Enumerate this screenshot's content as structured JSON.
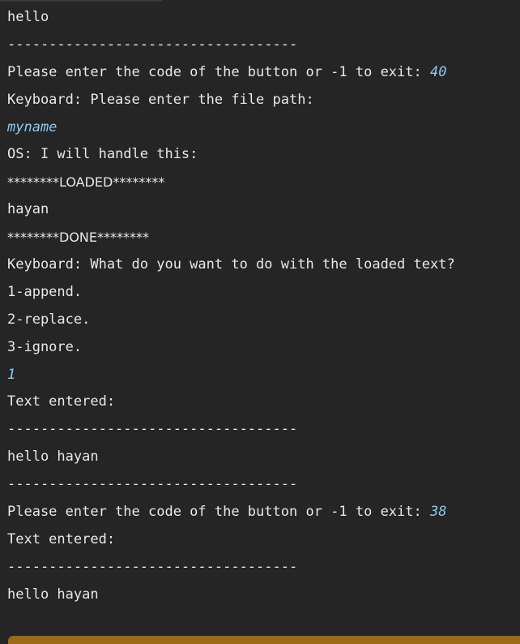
{
  "terminal": {
    "lines": [
      {
        "text": "hello"
      },
      {
        "text": "-----------------------------------"
      },
      {
        "text": "Please enter the code of the button or -1 to exit: ",
        "input": "40"
      },
      {
        "text": "Keyboard: Please enter the file path:"
      },
      {
        "text": "",
        "input": "myname"
      },
      {
        "text": "OS: I will handle this:"
      },
      {
        "text": "********LOADED********"
      },
      {
        "text": "hayan"
      },
      {
        "text": "********DONE********"
      },
      {
        "text": "Keyboard: What do you want to do with the loaded text?"
      },
      {
        "text": "1-append."
      },
      {
        "text": "2-replace."
      },
      {
        "text": "3-ignore."
      },
      {
        "text": "",
        "input": "1"
      },
      {
        "text": "Text entered:"
      },
      {
        "text": "-----------------------------------"
      },
      {
        "text": "hello hayan"
      },
      {
        "text": "-----------------------------------"
      },
      {
        "text": "Please enter the code of the button or -1 to exit: ",
        "input": "38"
      },
      {
        "text": "Text entered:"
      },
      {
        "text": "-----------------------------------"
      },
      {
        "text": "hello hayan"
      }
    ]
  }
}
